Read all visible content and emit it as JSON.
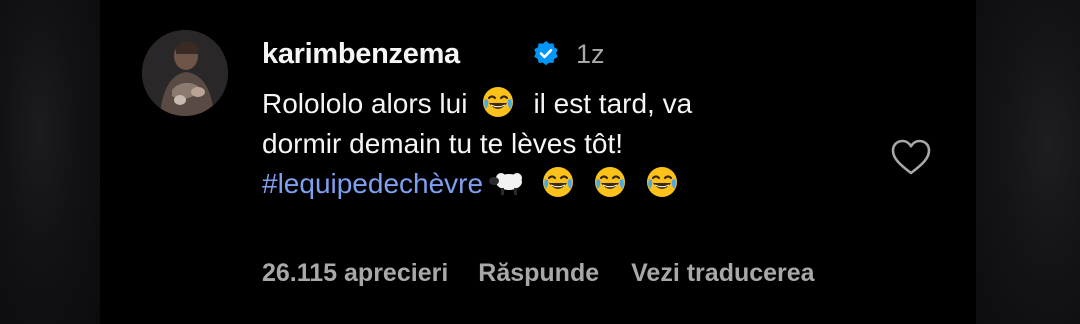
{
  "comment": {
    "username": "karimbenzema",
    "verified": true,
    "time": "1z",
    "text_line1_a": "Rolololo alors lui",
    "text_line1_b": "il est tard, va",
    "text_line2": "dormir demain tu te lèves tôt!",
    "hashtag": "#lequipedechèvre",
    "emojis": [
      "face-with-tears-of-joy-icon",
      "sheep-icon"
    ],
    "likes": "26.115 aprecieri",
    "reply_label": "Răspunde",
    "translate_label": "Vezi traducerea"
  },
  "colors": {
    "background": "#000000",
    "text": "#f5f5f5",
    "muted": "#a8a8a8",
    "hashtag": "#7f9ff0",
    "verified": "#0095f6"
  }
}
